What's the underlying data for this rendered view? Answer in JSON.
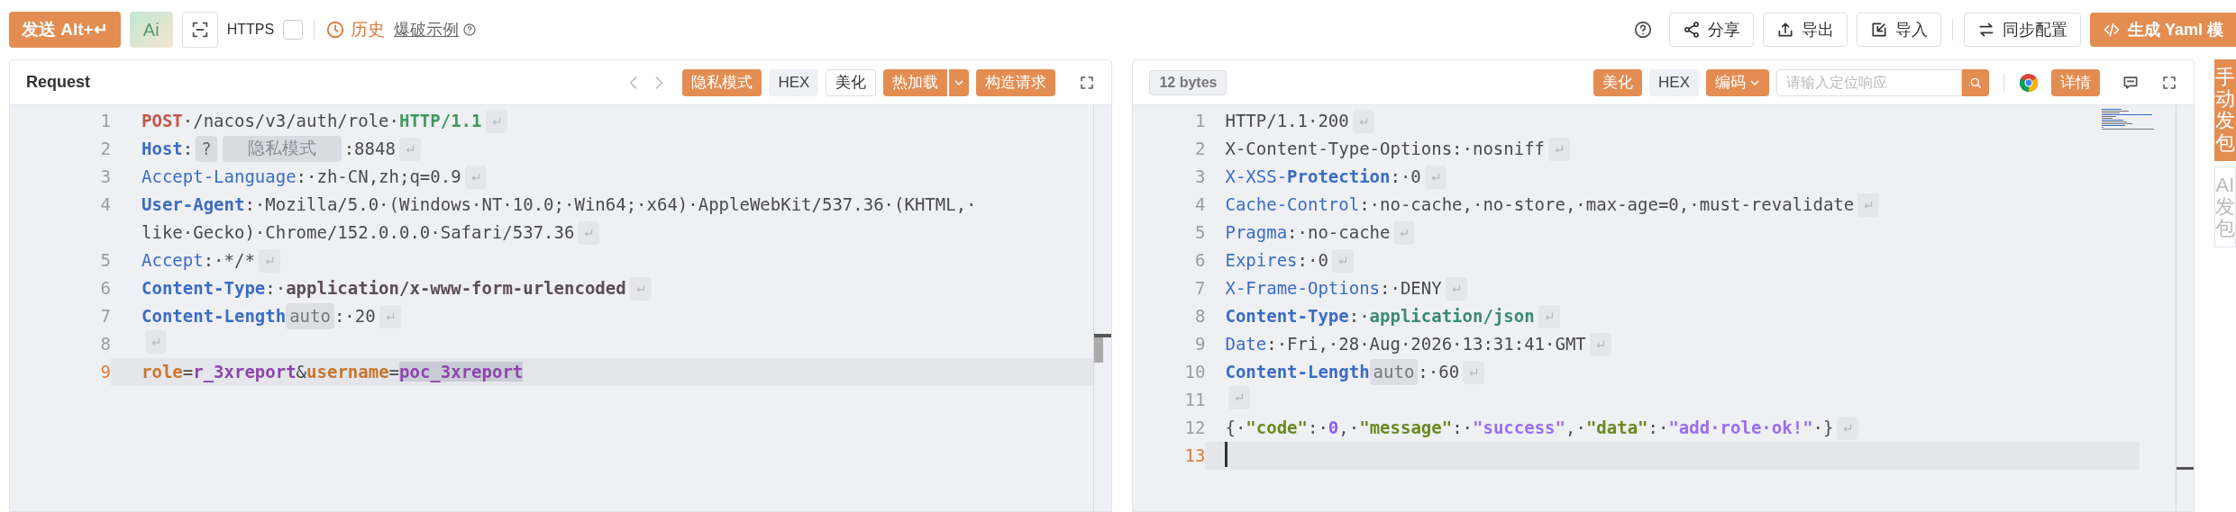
{
  "toolbar": {
    "send_button": "发送 Alt+↵",
    "ai_button": "Ai",
    "https": {
      "label": "HTTPS",
      "checked": false
    },
    "history_link": "历史",
    "example_link": "爆破示例",
    "right_buttons": [
      {
        "label": "分享",
        "kind": "share"
      },
      {
        "label": "导出",
        "kind": "export"
      },
      {
        "label": "导入",
        "kind": "import"
      },
      {
        "label": "同步配置",
        "kind": "sync"
      },
      {
        "label": "生成 Yaml 模",
        "kind": "generate"
      }
    ]
  },
  "request": {
    "title": "Request",
    "buttons": [
      {
        "label": "隐私模式",
        "kind": "primary"
      },
      {
        "label": "HEX",
        "kind": "muted"
      },
      {
        "label": "美化",
        "kind": "outline"
      },
      {
        "label": "热加载",
        "kind": "split"
      },
      {
        "label": "构造请求",
        "kind": "primary"
      }
    ],
    "lines": [
      {
        "number": "1",
        "eol": true,
        "current": false,
        "segments": [
          {
            "text": "POST",
            "kind": "method"
          },
          {
            "text": "·/nacos/v3/auth/role·",
            "kind": "plain"
          },
          {
            "text": "HTTP/1.1",
            "kind": "version"
          }
        ]
      },
      {
        "number": "2",
        "eol": true,
        "current": false,
        "segments": [
          {
            "text": "Host",
            "kind": "key"
          },
          {
            "text": ":",
            "kind": "plain"
          },
          {
            "text": "?",
            "kind": "mask_badge"
          },
          {
            "text": "隐私模式",
            "kind": "mask"
          },
          {
            "text": ":8848",
            "kind": "plain"
          }
        ]
      },
      {
        "number": "3",
        "eol": true,
        "current": false,
        "segments": [
          {
            "text": "Accept-Language",
            "kind": "header"
          },
          {
            "text": ":·zh-CN,zh;q=0.9",
            "kind": "plain"
          }
        ]
      },
      {
        "number": "4",
        "eol": true,
        "current": false,
        "segments": [
          {
            "text": "User-Agent",
            "kind": "key"
          },
          {
            "text": ":·Mozilla/5.0·(Windows·NT·10.0;·Win64;·x64)·AppleWebKit/537.36·(KHTML,·",
            "kind": "plain"
          },
          {
            "text": "like·Gecko)·Chrome/152.0.0.0·Safari/537.36",
            "kind": "plain",
            "wrap_before": true
          }
        ]
      },
      {
        "number": "5",
        "eol": true,
        "current": false,
        "segments": [
          {
            "text": "Accept",
            "kind": "header"
          },
          {
            "text": ":·*/*",
            "kind": "plain"
          }
        ]
      },
      {
        "number": "6",
        "eol": true,
        "current": false,
        "segments": [
          {
            "text": "Content-Type",
            "kind": "key"
          },
          {
            "text": ":·",
            "kind": "plain"
          },
          {
            "text": "application/x-www-form-urlencoded",
            "kind": "strong"
          }
        ]
      },
      {
        "number": "7",
        "eol": true,
        "current": false,
        "segments": [
          {
            "text": "Content-Length",
            "kind": "key"
          },
          {
            "text": "auto",
            "kind": "tag"
          },
          {
            "text": ":·20",
            "kind": "plain"
          }
        ]
      },
      {
        "number": "8",
        "eol": true,
        "current": false
      },
      {
        "number": "9",
        "eol": false,
        "current": true,
        "segments": [
          {
            "text": "role",
            "kind": "param"
          },
          {
            "text": "=",
            "kind": "plain"
          },
          {
            "text": "r_3xreport",
            "kind": "pvalue"
          },
          {
            "text": "&",
            "kind": "plain"
          },
          {
            "text": "username",
            "kind": "param"
          },
          {
            "text": "=",
            "kind": "plain"
          },
          {
            "text": "poc_3xreport",
            "kind": "pvalue",
            "selected": true
          }
        ]
      }
    ]
  },
  "response": {
    "size_badge": "12 bytes",
    "buttons": [
      {
        "label": "美化",
        "kind": "primary"
      },
      {
        "label": "HEX",
        "kind": "muted"
      },
      {
        "label": "编码",
        "kind": "dropdown"
      }
    ],
    "search": {
      "placeholder": "请输入定位响应"
    },
    "detail_button": "详情",
    "lines": [
      {
        "number": "1",
        "eol": true,
        "current": false,
        "segments": [
          {
            "text": "HTTP/1.1·200",
            "kind": "plain"
          }
        ]
      },
      {
        "number": "2",
        "eol": true,
        "current": false,
        "segments": [
          {
            "text": "X-Content-Type-Options:·nosniff",
            "kind": "plain"
          }
        ]
      },
      {
        "number": "3",
        "eol": true,
        "current": false,
        "segments": [
          {
            "text": "X-XSS-",
            "kind": "header"
          },
          {
            "text": "Protection",
            "kind": "key"
          },
          {
            "text": ":·0",
            "kind": "plain"
          }
        ]
      },
      {
        "number": "4",
        "eol": true,
        "current": false,
        "segments": [
          {
            "text": "Cache-Control",
            "kind": "header"
          },
          {
            "text": ":·no-cache,·no-store,·max-age=0,·must-revalidate",
            "kind": "plain"
          }
        ]
      },
      {
        "number": "5",
        "eol": true,
        "current": false,
        "segments": [
          {
            "text": "Pragma",
            "kind": "header"
          },
          {
            "text": ":·no-cache",
            "kind": "plain"
          }
        ]
      },
      {
        "number": "6",
        "eol": true,
        "current": false,
        "segments": [
          {
            "text": "Expires",
            "kind": "header"
          },
          {
            "text": ":·0",
            "kind": "plain"
          }
        ]
      },
      {
        "number": "7",
        "eol": true,
        "current": false,
        "segments": [
          {
            "text": "X-Frame-Options",
            "kind": "header"
          },
          {
            "text": ":·DENY",
            "kind": "plain"
          }
        ]
      },
      {
        "number": "8",
        "eol": true,
        "current": false,
        "segments": [
          {
            "text": "Content-Type",
            "kind": "key"
          },
          {
            "text": ":·",
            "kind": "plain"
          },
          {
            "text": "application/json",
            "kind": "mime"
          }
        ]
      },
      {
        "number": "9",
        "eol": true,
        "current": false,
        "segments": [
          {
            "text": "Date",
            "kind": "header"
          },
          {
            "text": ":·Fri,·28·Aug·2026·13:31:41·GMT",
            "kind": "plain"
          }
        ]
      },
      {
        "number": "10",
        "eol": true,
        "current": false,
        "segments": [
          {
            "text": "Content-Length",
            "kind": "key"
          },
          {
            "text": "auto",
            "kind": "tag"
          },
          {
            "text": ":·60",
            "kind": "plain"
          }
        ]
      },
      {
        "number": "11",
        "eol": true,
        "current": false
      },
      {
        "number": "12",
        "eol": true,
        "current": false,
        "segments": [
          {
            "text": "{·",
            "kind": "plain"
          },
          {
            "text": "\"code\"",
            "kind": "jkey"
          },
          {
            "text": ":·",
            "kind": "plain"
          },
          {
            "text": "0",
            "kind": "num"
          },
          {
            "text": ",·",
            "kind": "plain"
          },
          {
            "text": "\"message\"",
            "kind": "jkey"
          },
          {
            "text": ":·",
            "kind": "plain"
          },
          {
            "text": "\"success\"",
            "kind": "jstr"
          },
          {
            "text": ",·",
            "kind": "plain"
          },
          {
            "text": "\"data\"",
            "kind": "jkey"
          },
          {
            "text": ":·",
            "kind": "plain"
          },
          {
            "text": "\"add·role·ok!\"",
            "kind": "jstr"
          },
          {
            "text": "·}",
            "kind": "plain"
          }
        ]
      },
      {
        "number": "13",
        "eol": false,
        "current": true
      }
    ]
  },
  "side_tabs": [
    {
      "label": "手动发包",
      "selected": true
    },
    {
      "label": "AI发包",
      "selected": false
    }
  ]
}
